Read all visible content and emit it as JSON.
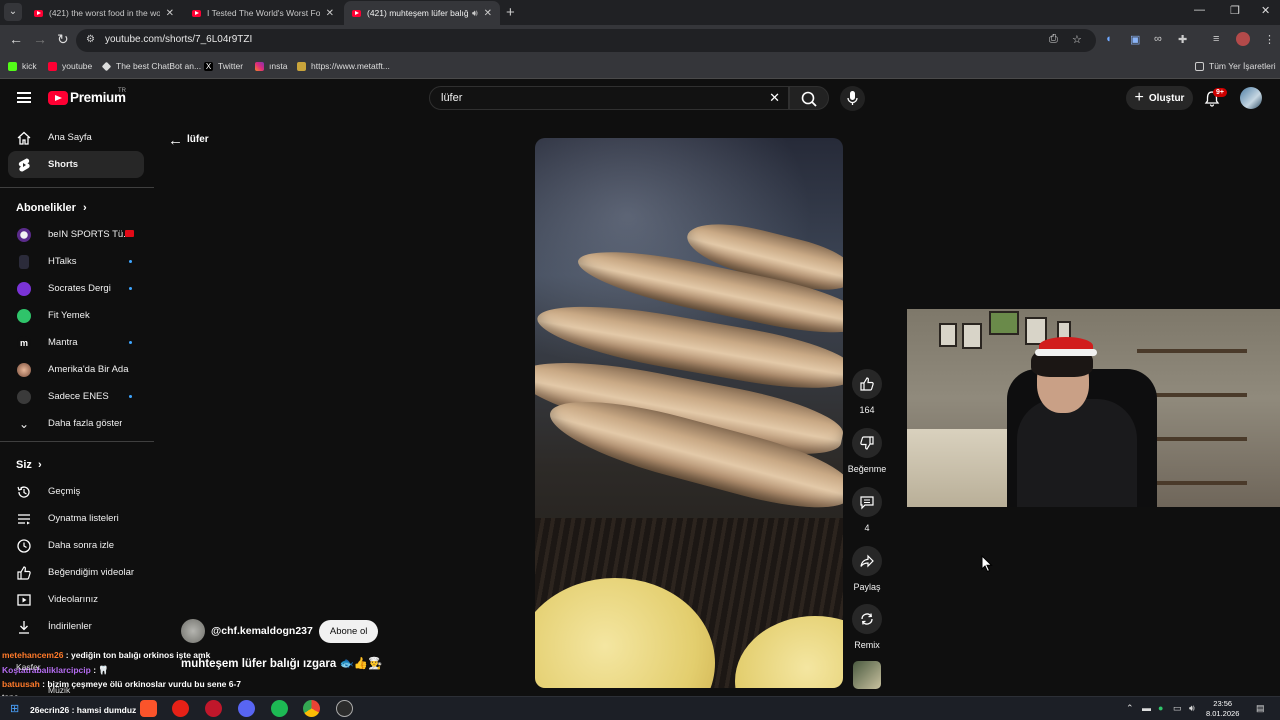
{
  "browser": {
    "tabs": [
      {
        "title": "(421) the worst food in the wo"
      },
      {
        "title": "I Tested The World's Worst Foo"
      },
      {
        "title": "(421) muhteşem lüfer balığ"
      }
    ],
    "url": "youtube.com/shorts/7_6L04r9TZI",
    "bookmarks": [
      "kick",
      "youtube",
      "The best ChatBot an...",
      "Twitter",
      "ınsta",
      "https://www.metatft..."
    ],
    "all_bookmarks": "Tüm Yer İşaretleri"
  },
  "header": {
    "brand": "Premium",
    "region": "TR",
    "search_value": "lüfer",
    "create_label": "Oluştur",
    "notif_count": "9+"
  },
  "sidebar": {
    "main": [
      {
        "label": "Ana Sayfa",
        "icon": "home-icon"
      },
      {
        "label": "Shorts",
        "icon": "shorts-icon"
      }
    ],
    "subs_heading": "Abonelikler",
    "subs": [
      {
        "label": "beIN SPORTS Tü..."
      },
      {
        "label": "HTalks"
      },
      {
        "label": "Socrates Dergi"
      },
      {
        "label": "Fit Yemek"
      },
      {
        "label": "Mantra"
      },
      {
        "label": "Amerika'da Bir Ada"
      },
      {
        "label": "Sadece ENES"
      },
      {
        "label": "Daha fazla göster"
      }
    ],
    "you_heading": "Siz",
    "you": [
      {
        "label": "Geçmiş"
      },
      {
        "label": "Oynatma listeleri"
      },
      {
        "label": "Daha sonra izle"
      },
      {
        "label": "Beğendiğim videolar"
      },
      {
        "label": "Videolarınız"
      },
      {
        "label": "İndirilenler"
      }
    ]
  },
  "shorts": {
    "back_query": "lüfer",
    "channel": "@chf.kemaldogn237",
    "subscribe_label": "Abone ol",
    "title": "muhteşem lüfer balığı ızgara 🐟👍👨‍🍳",
    "actions": {
      "likes": "164",
      "dislike_label": "Beğenme",
      "comments": "4",
      "share_label": "Paylaş",
      "remix_label": "Remix"
    }
  },
  "chat": [
    {
      "user": "metehancem26",
      "msg": ": yediğin ton balığı orkinos işte amk"
    },
    {
      "user": "Koştatrabaliklarcipcip",
      "msg": ": 🦷"
    },
    {
      "user": "batuusah",
      "msg": ": bizim çeşmeye ölü orkinoslar vurdu bu sene 6-7"
    },
    {
      "user": "26ecrin26",
      "msg": ": hamsi dumduz"
    }
  ],
  "chat_fragments": {
    "kasfer": "Kasfer",
    "muzik": "Müzik",
    "tane": "tane"
  },
  "taskbar": {
    "time": "23:56",
    "date": "8.01.2026"
  }
}
